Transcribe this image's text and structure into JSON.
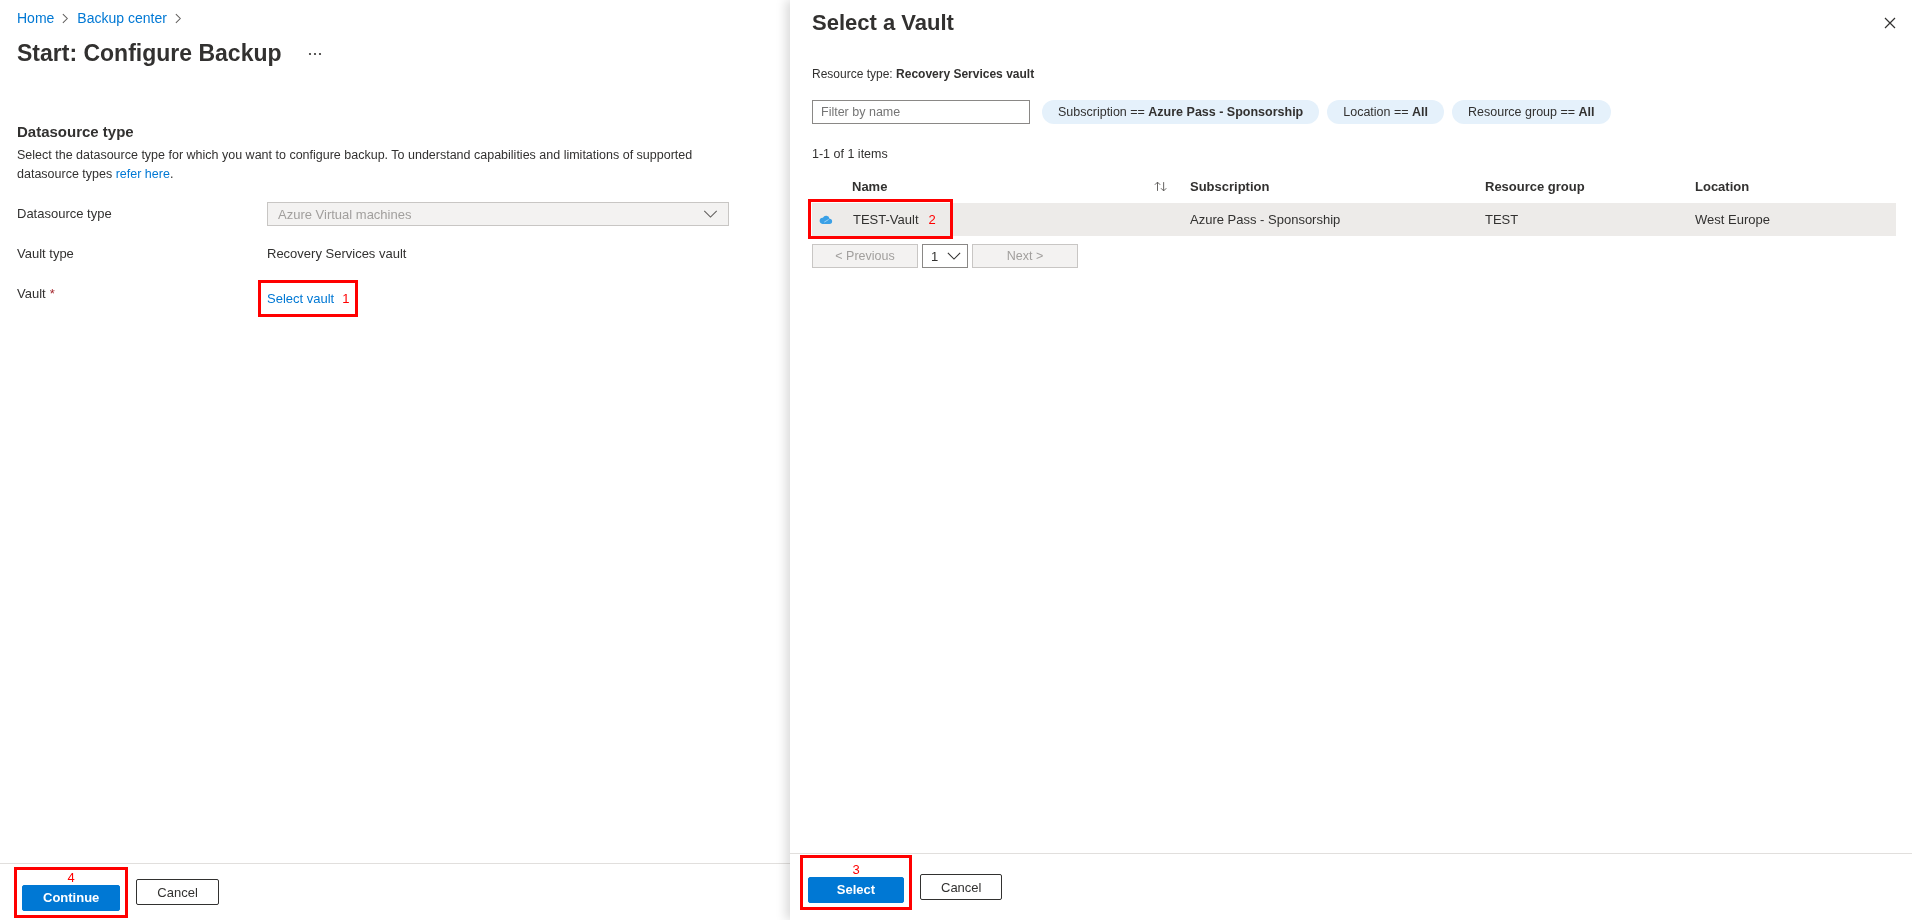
{
  "breadcrumb": [
    {
      "label": "Home"
    },
    {
      "label": "Backup center"
    }
  ],
  "page_title": "Start: Configure Backup",
  "section": {
    "heading": "Datasource type",
    "description": "Select the datasource type for which you want to configure backup. To understand capabilities and limitations of supported datasource types",
    "link": "refer here",
    "description_end": "."
  },
  "form": [
    {
      "label": "Datasource type",
      "kind": "dropdown",
      "value": "Azure Virtual machines",
      "disabled": true
    },
    {
      "label": "Vault type",
      "kind": "text",
      "value": "Recovery Services vault"
    },
    {
      "label": "Vault",
      "kind": "link",
      "value": "Select vault",
      "required_mark": "*",
      "annotation": "1"
    }
  ],
  "footer_buttons": [
    {
      "label": "Continue",
      "kind": "primary",
      "annotation": "4"
    },
    {
      "label": "Cancel",
      "kind": "secondary"
    }
  ],
  "panel": {
    "title": "Select a Vault",
    "resource_type_label": "Resource type:",
    "resource_type": "Recovery Services vault",
    "filter": {
      "placeholder": "Filter by name"
    },
    "pills": [
      {
        "label": "Subscription ==",
        "value": "Azure Pass - Sponsorship"
      },
      {
        "label": "Location ==",
        "value": "All"
      },
      {
        "label": "Resource group ==",
        "value": "All"
      }
    ],
    "count": "1-1 of 1 items",
    "columns": [
      "Name",
      "Subscription",
      "Resource group",
      "Location"
    ],
    "rows": [
      {
        "cells": [
          "TEST-Vault",
          "Azure Pass - Sponsorship",
          "TEST",
          "West Europe"
        ],
        "selected": true,
        "annotation": "2"
      }
    ],
    "pagination": {
      "previous": {
        "label": "< Previous",
        "disabled": true
      },
      "page": "1",
      "next": {
        "label": "Next >",
        "disabled": true
      }
    },
    "buttons": [
      {
        "label": "Select",
        "kind": "primary",
        "annotation": "3"
      },
      {
        "label": "Cancel",
        "kind": "secondary"
      }
    ]
  }
}
